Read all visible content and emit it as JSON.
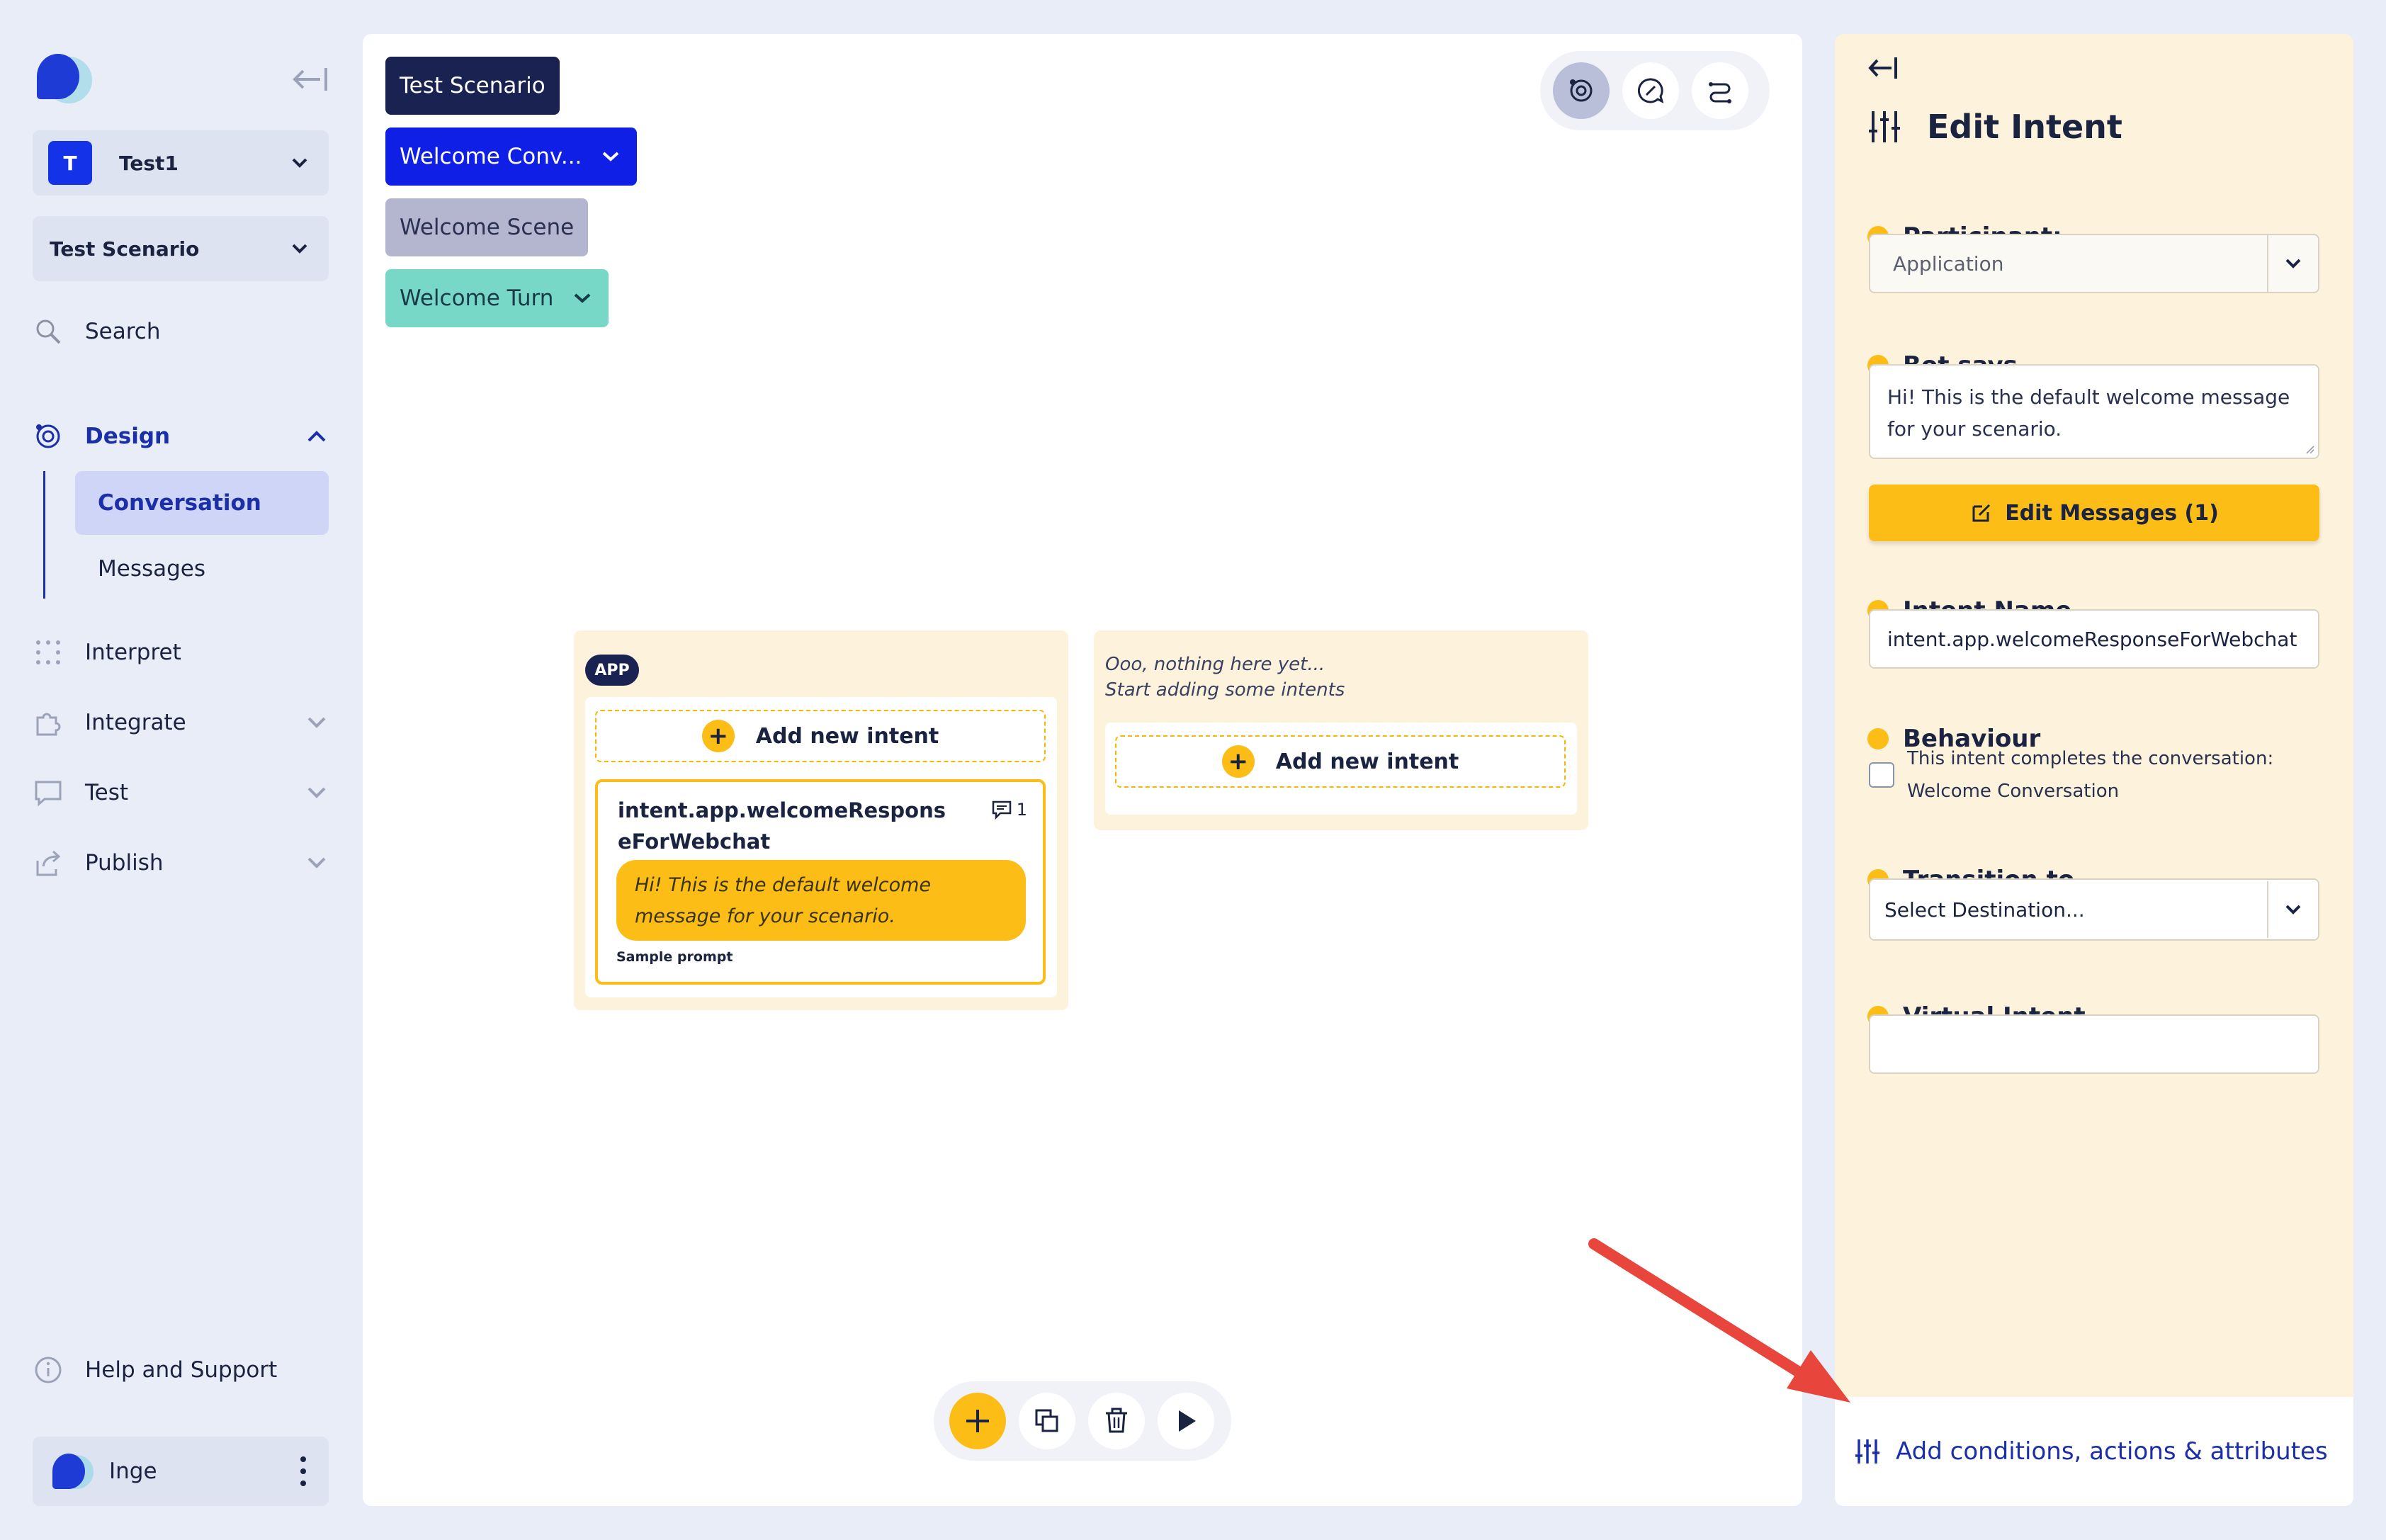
{
  "sidebar": {
    "workspace": {
      "initial": "T",
      "name": "Test1"
    },
    "scenario": {
      "name": "Test Scenario"
    },
    "nav": {
      "search": "Search",
      "design": "Design",
      "conversation": "Conversation",
      "messages": "Messages",
      "interpret": "Interpret",
      "integrate": "Integrate",
      "test": "Test",
      "publish": "Publish",
      "help": "Help and Support"
    },
    "user": {
      "name": "Inge"
    }
  },
  "canvas": {
    "breadcrumbs": {
      "scenario": "Test Scenario",
      "conversation": "Welcome Conv...",
      "scene": "Welcome Scene",
      "turn": "Welcome Turn"
    },
    "app_column": {
      "badge": "APP",
      "add_intent_label": "Add new intent",
      "intent": {
        "name": "intent.app.welcomeResponseForWebchat",
        "message_count": "1",
        "message": "Hi! This is the default welcome message for your scenario.",
        "sample_label": "Sample prompt"
      }
    },
    "empty_column": {
      "line1": "Ooo, nothing here yet...",
      "line2": "Start adding some intents",
      "add_intent_label": "Add new intent"
    }
  },
  "panel": {
    "title": "Edit Intent",
    "participant": {
      "label": "Participant:",
      "value": "Application"
    },
    "bot_says": {
      "label": "Bot says",
      "value": "Hi! This is the default welcome message for your scenario."
    },
    "edit_messages_label": "Edit Messages (1)",
    "intent_name": {
      "label": "Intent Name",
      "value": "intent.app.welcomeResponseForWebchat"
    },
    "behaviour": {
      "label": "Behaviour",
      "checkbox_text": "This intent completes the conversation: Welcome Conversation",
      "checked": false
    },
    "transition": {
      "label": "Transition to",
      "value": "Select Destination..."
    },
    "virtual_intent": {
      "label": "Virtual Intent",
      "value": ""
    },
    "footer_label": "Add conditions, actions & attributes"
  },
  "colors": {
    "accent_yellow": "#fbbd16",
    "navy": "#1a2251",
    "brand_blue": "#0f1fe6",
    "teal": "#77d8c8",
    "annotation_arrow": "#e8453c"
  }
}
